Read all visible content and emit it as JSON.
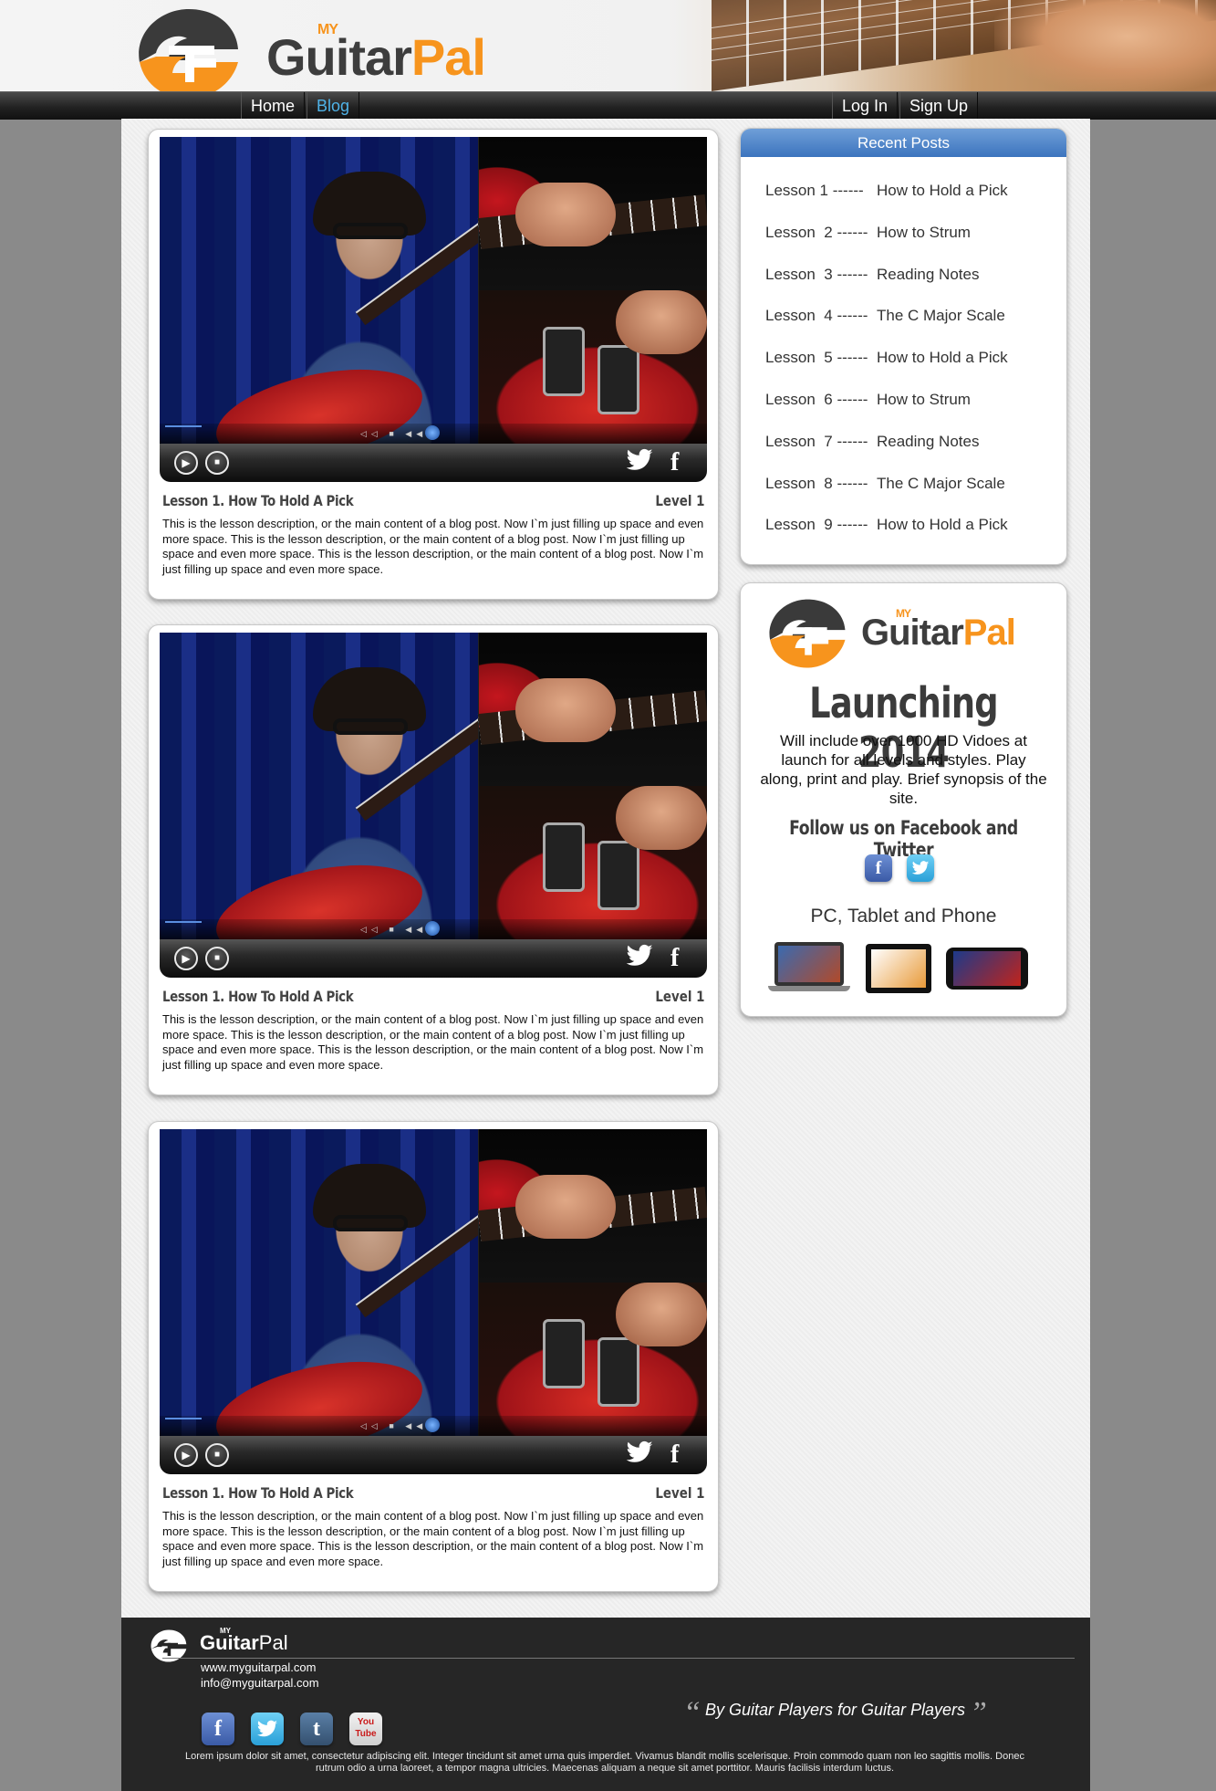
{
  "site": {
    "brand_prefix": "MY",
    "brand_main": "Guitar",
    "brand_accent": "Pal",
    "colors": {
      "accent_orange": "#f7941d",
      "link_blue": "#4fb3e8",
      "header_blue": "#3c74be"
    }
  },
  "nav": {
    "home": "Home",
    "blog": "Blog",
    "login": "Log In",
    "signup": "Sign Up"
  },
  "posts": [
    {
      "title": "Lesson 1.  How To Hold A Pick",
      "level": "Level 1",
      "description": "This is the lesson description, or the main content of a blog post.  Now I`m just filling up space and even more space.  This is the lesson description, or the main content of a blog post.  Now I`m just filling up space and even more space.  This is the lesson description, or the main content of a blog post.  Now I`m just filling up space and even more space."
    },
    {
      "title": "Lesson 1.  How To Hold A Pick",
      "level": "Level 1",
      "description": "This is the lesson description, or the main content of a blog post.  Now I`m just filling up space and even more space.  This is the lesson description, or the main content of a blog post.  Now I`m just filling up space and even more space.  This is the lesson description, or the main content of a blog post.  Now I`m just filling up space and even more space."
    },
    {
      "title": "Lesson 1.  How To Hold A Pick",
      "level": "Level 1",
      "description": "This is the lesson description, or the main content of a blog post.  Now I`m just filling up space and even more space.  This is the lesson description, or the main content of a blog post.  Now I`m just filling up space and even more space.  This is the lesson description, or the main content of a blog post.  Now I`m just filling up space and even more space."
    }
  ],
  "video_icons": {
    "play": "play-icon",
    "stop": "stop-icon",
    "twitter": "twitter-icon",
    "facebook": "facebook-icon"
  },
  "recent_posts": {
    "heading": "Recent Posts",
    "items": [
      {
        "num": "Lesson 1 ------",
        "title": "How to Hold a Pick"
      },
      {
        "num": "Lesson  2 ------",
        "title": "How to Strum"
      },
      {
        "num": "Lesson  3 ------",
        "title": "Reading Notes"
      },
      {
        "num": "Lesson  4 ------",
        "title": "The C Major Scale"
      },
      {
        "num": "Lesson  5 ------",
        "title": "How to Hold a Pick"
      },
      {
        "num": "Lesson  6 ------",
        "title": "How to Strum"
      },
      {
        "num": "Lesson  7 ------",
        "title": "Reading Notes"
      },
      {
        "num": "Lesson  8 ------",
        "title": "The C Major Scale"
      },
      {
        "num": "Lesson  9 ------",
        "title": "How to Hold a Pick"
      }
    ]
  },
  "promo": {
    "launching": "Launching 2014",
    "text": "Will include over 1000 HD Vidoes at launch for all levels and styles.  Play along, print and play.  Brief synopsis of the site.",
    "follow": "Follow us on Facebook and Twitter",
    "devices": "PC, Tablet and Phone"
  },
  "footer": {
    "website": "www.myguitarpal.com",
    "email": "info@myguitarpal.com",
    "tagline": "By Guitar Players for Guitar Players",
    "lorem": "Lorem ipsum dolor sit amet, consectetur adipiscing elit. Integer tincidunt sit amet urna quis imperdiet. Vivamus blandit mollis scelerisque. Proin commodo quam non leo sagittis mollis. Donec rutrum odio a urna laoreet, a tempor magna ultricies. Maecenas aliquam a neque sit amet porttitor. Mauris facilisis interdum luctus.",
    "social": [
      "facebook-icon",
      "twitter-icon",
      "tumblr-icon",
      "youtube-icon"
    ],
    "youtube_label": "You Tube"
  }
}
